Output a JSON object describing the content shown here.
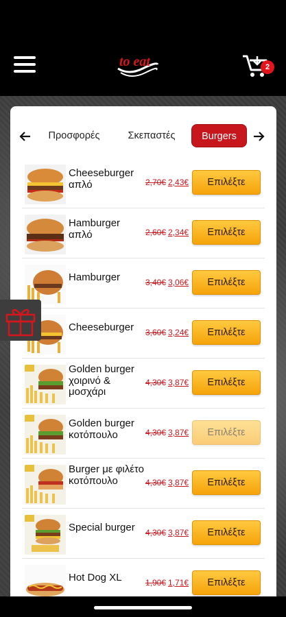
{
  "header": {
    "logo_text": "to eat",
    "cart_count": "2"
  },
  "tabs": [
    {
      "label": "Προσφορές",
      "active": false
    },
    {
      "label": "Σκεπαστές",
      "active": false
    },
    {
      "label": "Burgers",
      "active": true
    }
  ],
  "products": [
    {
      "name": "Cheeseburger απλό",
      "old_price": "2,70€",
      "new_price": "2,43€",
      "button": "Επιλέξτε",
      "image": "cheeseburger"
    },
    {
      "name": "Hamburger απλό",
      "old_price": "2,60€",
      "new_price": "2,34€",
      "button": "Επιλέξτε",
      "image": "hamburger"
    },
    {
      "name": "Hamburger",
      "old_price": "3,40€",
      "new_price": "3,06€",
      "button": "Επιλέξτε",
      "image": "hamburger-fries"
    },
    {
      "name": "Cheeseburger",
      "old_price": "3,60€",
      "new_price": "3,24€",
      "button": "Επιλέξτε",
      "image": "cheeseburger-fries"
    },
    {
      "name": "Golden burger χοιρινό & μοσχάρι",
      "old_price": "4,30€",
      "new_price": "3,87€",
      "button": "Επιλέξτε",
      "image": "golden-burger"
    },
    {
      "name": "Golden burger κοτόπουλο",
      "old_price": "4,30€",
      "new_price": "3,87€",
      "button": "Επιλέξτε",
      "image": "golden-burger"
    },
    {
      "name": "Burger με φιλέτο κοτόπουλο",
      "old_price": "4,30€",
      "new_price": "3,87€",
      "button": "Επιλέξτε",
      "image": "chicken-burger"
    },
    {
      "name": "Special burger",
      "old_price": "4,30€",
      "new_price": "3,87€",
      "button": "Επιλέξτε",
      "image": "special-burger"
    },
    {
      "name": "Hot Dog XL",
      "old_price": "1,90€",
      "new_price": "1,71€",
      "button": "Επιλέξτε",
      "image": "hot-dog"
    }
  ],
  "icons": {
    "menu": "hamburger-menu-icon",
    "cart": "shopping-cart-icon",
    "prev": "arrow-left-icon",
    "next": "arrow-right-icon",
    "gift": "gift-icon"
  },
  "colors": {
    "brand_red": "#c8161d",
    "button_yellow": "#f5a30a"
  }
}
